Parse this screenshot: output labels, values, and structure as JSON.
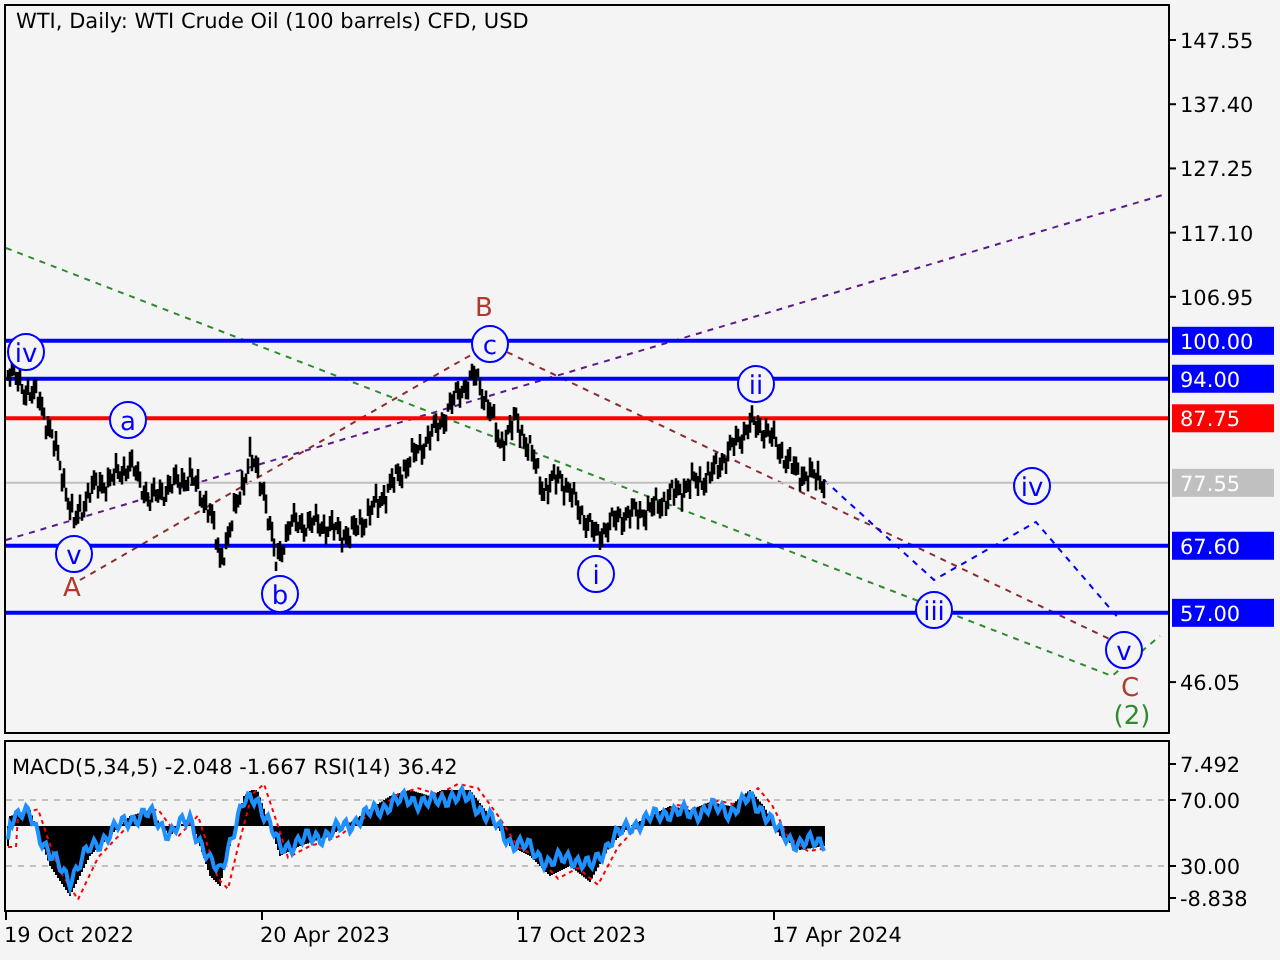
{
  "title": "WTI, Daily:  WTI Crude Oil (100 barrels) CFD, USD",
  "price_axis": {
    "ticks": [
      "147.55",
      "137.40",
      "127.25",
      "117.10",
      "106.95",
      "46.05"
    ]
  },
  "levels": [
    {
      "label": "100.00",
      "color": "#0000ff",
      "kind": "level"
    },
    {
      "label": "94.00",
      "color": "#0000ff",
      "kind": "level"
    },
    {
      "label": "87.75",
      "color": "#ff0000",
      "kind": "level"
    },
    {
      "label": "77.55",
      "color": "#c0c0c0",
      "kind": "current_price"
    },
    {
      "label": "67.60",
      "color": "#0000ff",
      "kind": "level"
    },
    {
      "label": "57.00",
      "color": "#0000ff",
      "kind": "level"
    }
  ],
  "wave_labels": [
    {
      "text": "iv",
      "kind": "circled",
      "color": "#0000ff"
    },
    {
      "text": "a",
      "kind": "circled",
      "color": "#0000ff"
    },
    {
      "text": "v",
      "kind": "circled",
      "color": "#0000ff"
    },
    {
      "text": "A",
      "kind": "plain",
      "color": "#b03a2e"
    },
    {
      "text": "b",
      "kind": "circled",
      "color": "#0000ff"
    },
    {
      "text": "B",
      "kind": "plain",
      "color": "#b03a2e"
    },
    {
      "text": "c",
      "kind": "circled",
      "color": "#0000ff"
    },
    {
      "text": "i",
      "kind": "circled",
      "color": "#0000ff"
    },
    {
      "text": "ii",
      "kind": "circled",
      "color": "#0000ff"
    },
    {
      "text": "iii",
      "kind": "circled",
      "color": "#0000ff"
    },
    {
      "text": "iv",
      "kind": "circled",
      "color": "#0000ff"
    },
    {
      "text": "v",
      "kind": "circled",
      "color": "#0000ff"
    },
    {
      "text": "C",
      "kind": "plain",
      "color": "#b03a2e"
    },
    {
      "text": "(2)",
      "kind": "plain",
      "color": "#2e8b2e"
    }
  ],
  "indicator": {
    "label": "MACD(5,34,5) -2.048 -1.667 RSI(14) 36.42",
    "ticks": [
      "7.492",
      "70.00",
      "30.00",
      "-8.838"
    ]
  },
  "time_axis": {
    "ticks": [
      "19 Oct 2022",
      "20 Apr 2023",
      "17 Oct 2023",
      "17 Apr 2024"
    ]
  }
}
